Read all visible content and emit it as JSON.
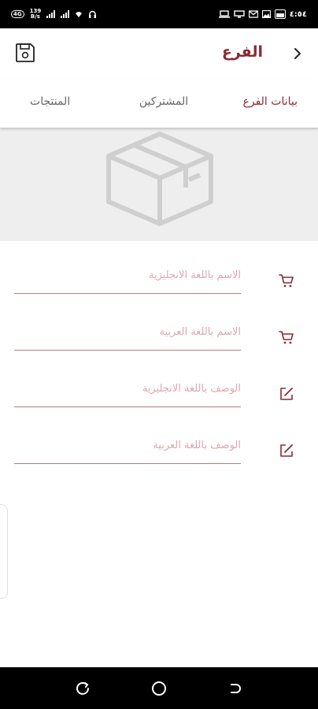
{
  "status_bar": {
    "speed_value": "139",
    "speed_unit": "B/s",
    "time": "٤:٥٤"
  },
  "app_bar": {
    "title": "الفرع",
    "back_icon": "chevron-right-icon",
    "save_icon": "floppy-disk-icon"
  },
  "tabs": [
    {
      "label": "بيانات الفرع",
      "active": true
    },
    {
      "label": "المشتركين",
      "active": false
    },
    {
      "label": "المنتجات",
      "active": false
    }
  ],
  "image_placeholder": {
    "icon": "package-box-icon"
  },
  "form": {
    "fields": [
      {
        "placeholder": "الاسم باللغة الانجليزية",
        "value": "",
        "icon": "cart-icon"
      },
      {
        "placeholder": "الاسم باللغة العربية",
        "value": "",
        "icon": "cart-icon"
      },
      {
        "placeholder": "الوصف باللغة الانجليزية",
        "value": "",
        "icon": "edit-icon"
      },
      {
        "placeholder": "الوصف باللغة العربية",
        "value": "",
        "icon": "edit-icon"
      }
    ]
  },
  "colors": {
    "accent": "#8a2a35",
    "underline": "#b87a82",
    "placeholder": "#dba8ae",
    "image_bg": "#eeeeee"
  }
}
